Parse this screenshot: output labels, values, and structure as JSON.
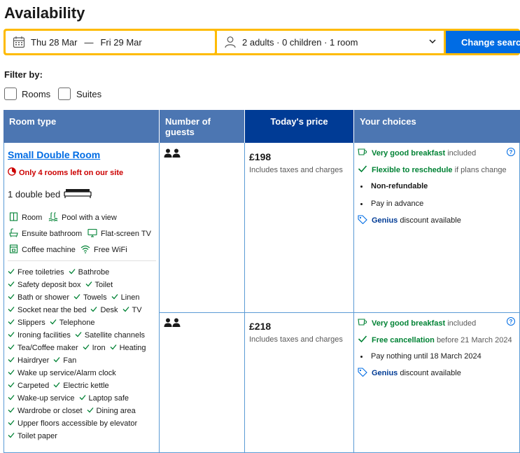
{
  "page": {
    "title": "Availability"
  },
  "search": {
    "checkin": "Thu 28 Mar",
    "dash": "—",
    "checkout": "Fri 29 Mar",
    "occupancy": "2 adults · 0 children · 1 room",
    "button_label": "Change search"
  },
  "filter": {
    "label": "Filter by:",
    "options": [
      {
        "label": "Rooms",
        "checked": false
      },
      {
        "label": "Suites",
        "checked": false
      }
    ]
  },
  "table": {
    "headers": [
      "Room type",
      "Number of guests",
      "Today's price",
      "Your choices"
    ]
  },
  "room": {
    "name": "Small Double Room",
    "scarcity": "Only 4 rooms left on our site",
    "bed": "1 double bed",
    "facilities": [
      {
        "label": "Room",
        "icon": "room-icon"
      },
      {
        "label": "Pool with a view",
        "icon": "pool-icon"
      },
      {
        "label": "Ensuite bathroom",
        "icon": "bath-icon"
      },
      {
        "label": "Flat-screen TV",
        "icon": "tv-icon"
      },
      {
        "label": "Coffee machine",
        "icon": "coffee-machine-icon"
      },
      {
        "label": "Free WiFi",
        "icon": "wifi-icon"
      }
    ],
    "amenities": [
      "Free toiletries",
      "Bathrobe",
      "Safety deposit box",
      "Toilet",
      "Bath or shower",
      "Towels",
      "Linen",
      "Socket near the bed",
      "Desk",
      "TV",
      "Slippers",
      "Telephone",
      "Ironing facilities",
      "Satellite channels",
      "Tea/Coffee maker",
      "Iron",
      "Heating",
      "Hairdryer",
      "Fan",
      "Wake up service/Alarm clock",
      "Carpeted",
      "Electric kettle",
      "Wake-up service",
      "Laptop safe",
      "Wardrobe or closet",
      "Dining area",
      "Upper floors accessible by elevator",
      "Toilet paper"
    ]
  },
  "options": [
    {
      "price": "£198",
      "price_note": "Includes taxes and charges",
      "breakfast_bold": "Very good breakfast",
      "breakfast_rest": "included",
      "policy_bold": "Flexible to reschedule",
      "policy_rest": "if plans change",
      "nonref": "Non-refundable",
      "payment": "Pay in advance",
      "genius": "Genius",
      "genius_rest": "discount available",
      "help": "?"
    },
    {
      "price": "£218",
      "price_note": "Includes taxes and charges",
      "breakfast_bold": "Very good breakfast",
      "breakfast_rest": "included",
      "policy_bold": "Free cancellation",
      "policy_rest": "before 21 March 2024",
      "payment": "Pay nothing until 18 March 2024",
      "genius": "Genius",
      "genius_rest": "discount available",
      "help": "?"
    }
  ],
  "colors": {
    "header_blue": "#4c76b2",
    "header_dark": "#003b95",
    "search_yellow": "#febb02",
    "button_blue": "#006ce4",
    "green": "#008234",
    "red": "#cc0000"
  }
}
